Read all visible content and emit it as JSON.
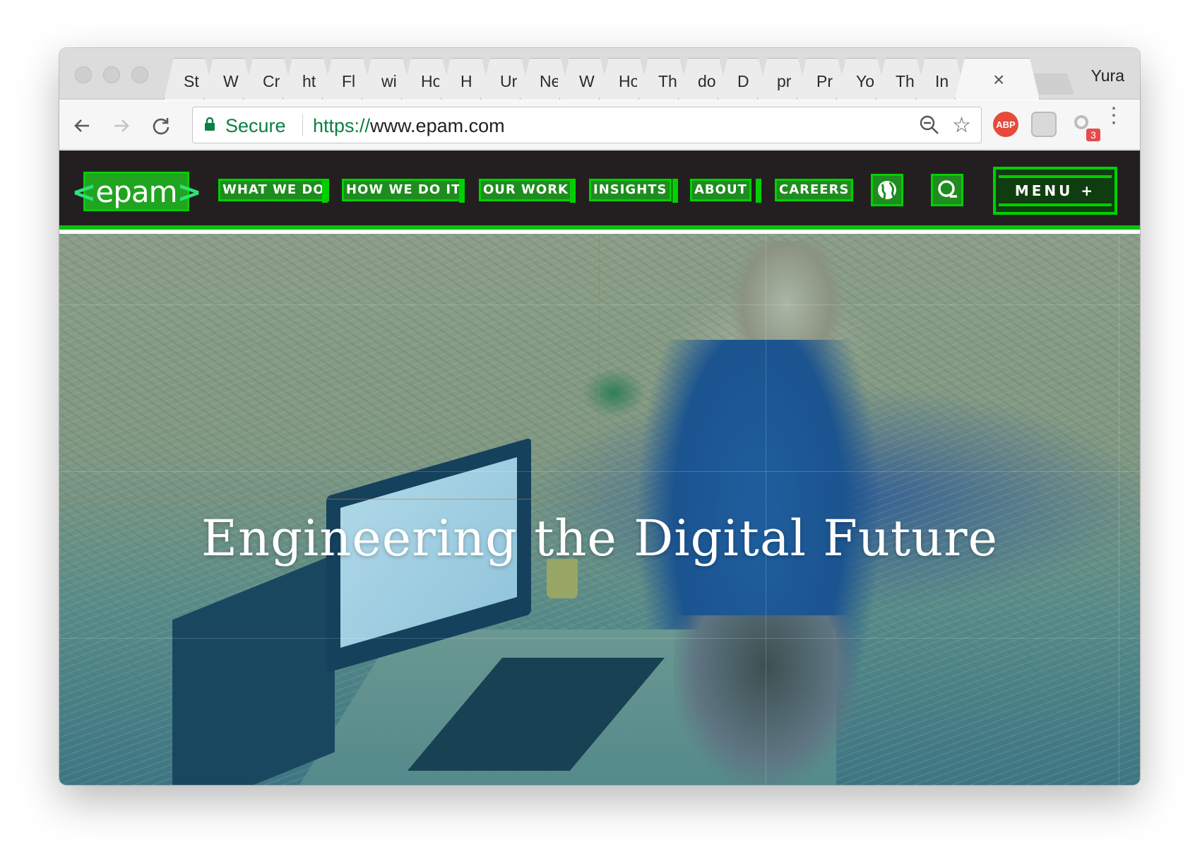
{
  "browser": {
    "tabs": [
      {
        "label": "St"
      },
      {
        "label": "W"
      },
      {
        "label": "Cr"
      },
      {
        "label": "ht"
      },
      {
        "label": "Fl"
      },
      {
        "label": "wi"
      },
      {
        "label": "Ho"
      },
      {
        "label": "H"
      },
      {
        "label": "Ur"
      },
      {
        "label": "Ne"
      },
      {
        "label": "W"
      },
      {
        "label": "Ho"
      },
      {
        "label": "Th"
      },
      {
        "label": "do"
      },
      {
        "label": "D"
      },
      {
        "label": "pr"
      },
      {
        "label": "Pr"
      },
      {
        "label": "Yo"
      },
      {
        "label": "Th"
      },
      {
        "label": "In"
      }
    ],
    "active_tab_close": "×",
    "profile_name": "Yura",
    "security_label": "Secure",
    "url_scheme": "https://",
    "url_host": "www.epam.com",
    "extensions": {
      "abp_label": "ABP",
      "badge_count": "3"
    },
    "accent_secure": "#0b8043"
  },
  "site": {
    "logo_text": "epam",
    "logo_bracket_left": "<",
    "logo_bracket_right": ">",
    "nav": [
      {
        "label": "WHAT WE DO"
      },
      {
        "label": "HOW WE DO IT"
      },
      {
        "label": "OUR WORK"
      },
      {
        "label": "INSIGHTS"
      },
      {
        "label": "ABOUT"
      },
      {
        "label": "CAREERS"
      }
    ],
    "menu_label": "MENU +",
    "hero_headline": "Engineering the Digital Future",
    "accent_green": "#00d000",
    "nav_background": "#231f20"
  }
}
